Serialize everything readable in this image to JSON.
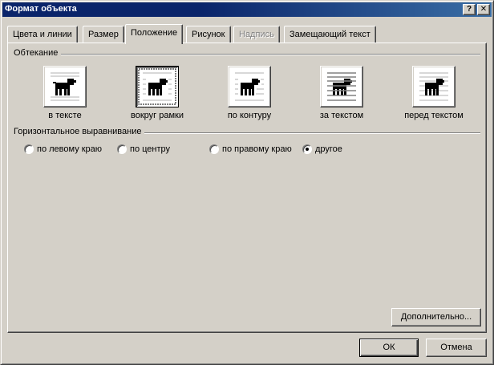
{
  "window": {
    "title": "Формат объекта",
    "help_glyph": "?",
    "close_glyph": "✕"
  },
  "tabs": [
    {
      "label": "Цвета и линии",
      "state": "normal"
    },
    {
      "label": "Размер",
      "state": "normal"
    },
    {
      "label": "Положение",
      "state": "active"
    },
    {
      "label": "Рисунок",
      "state": "normal"
    },
    {
      "label": "Надпись",
      "state": "disabled"
    },
    {
      "label": "Замещающий текст",
      "state": "normal"
    }
  ],
  "wrapping": {
    "group_label": "Обтекание",
    "options": [
      {
        "label": "в тексте",
        "icon": "dog-inline-icon",
        "selected": false
      },
      {
        "label": "вокруг рамки",
        "icon": "dog-square-icon",
        "selected": true
      },
      {
        "label": "по контуру",
        "icon": "dog-tight-icon",
        "selected": false
      },
      {
        "label": "за текстом",
        "icon": "dog-behind-text-icon",
        "selected": false
      },
      {
        "label": "перед текстом",
        "icon": "dog-in-front-icon",
        "selected": false
      }
    ]
  },
  "alignment": {
    "group_label": "Горизонтальное выравнивание",
    "options": [
      {
        "label": "по левому краю",
        "checked": false
      },
      {
        "label": "по центру",
        "checked": false
      },
      {
        "label": "по правому краю",
        "checked": false
      },
      {
        "label": "другое",
        "checked": true
      }
    ]
  },
  "buttons": {
    "advanced": "Дополнительно...",
    "ok": "ОК",
    "cancel": "Отмена"
  }
}
